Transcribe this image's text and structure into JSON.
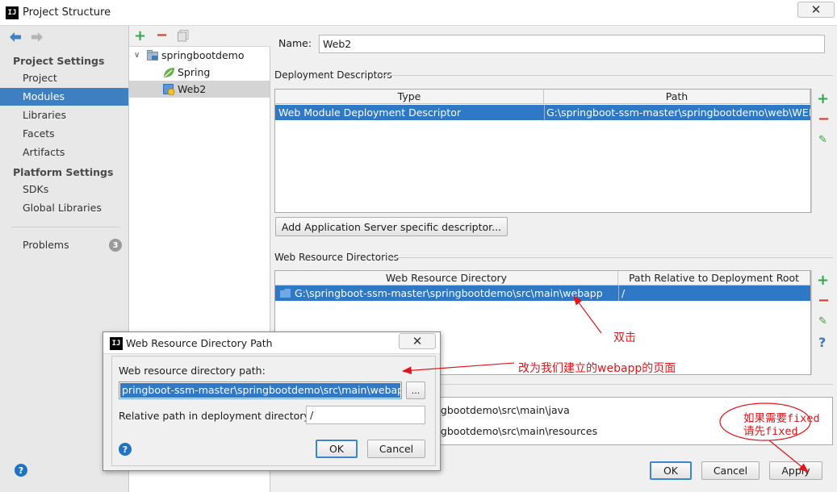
{
  "window": {
    "title": "Project Structure",
    "app_icon": "IJ",
    "close_glyph": "✕"
  },
  "nav": {
    "project_settings_header": "Project Settings",
    "project_settings_items": [
      "Project",
      "Modules",
      "Libraries",
      "Facets",
      "Artifacts"
    ],
    "platform_settings_header": "Platform Settings",
    "platform_settings_items": [
      "SDKs",
      "Global Libraries"
    ],
    "problems_label": "Problems",
    "problems_count": "3",
    "selected": "Modules"
  },
  "tree": {
    "root": "springbootdemo",
    "children": [
      "Spring",
      "Web2"
    ],
    "selected": "Web2"
  },
  "module": {
    "name_label": "Name:",
    "name_value": "Web2"
  },
  "deployment_descriptors": {
    "label": "Deployment Descriptors",
    "columns": [
      "Type",
      "Path"
    ],
    "row": {
      "type": "Web Module Deployment Descriptor",
      "path": "G:\\springboot-ssm-master\\springbootdemo\\web\\WEB-INF\\web.xml"
    },
    "add_button": "Add Application Server specific descriptor..."
  },
  "web_resource_directories": {
    "label": "Web Resource Directories",
    "columns": [
      "Web Resource Directory",
      "Path Relative to Deployment Root"
    ],
    "row": {
      "directory": "G:\\springboot-ssm-master\\springbootdemo\\src\\main\\webapp",
      "relative": "/"
    }
  },
  "source_roots": {
    "rows": [
      "ngbootdemo\\src\\main\\java",
      "ngbootdemo\\src\\main\\resources"
    ]
  },
  "buttons": {
    "ok": "OK",
    "cancel": "Cancel",
    "apply": "Apply"
  },
  "dialog": {
    "title": "Web Resource Directory Path",
    "path_label": "Web resource directory path:",
    "path_value": "pringboot-ssm-master\\springbootdemo\\src\\main\\webapp",
    "browse": "...",
    "relative_label": "Relative path in deployment directory:",
    "relative_value": "/",
    "ok": "OK",
    "cancel": "Cancel",
    "help": "?"
  },
  "annotations": {
    "double_click": "双击",
    "change_to": "改为我们建立的webapp的页面",
    "fixed_line1": "如果需要fixed",
    "fixed_line2": "请先fixed"
  },
  "colors": {
    "selection": "#2e78c5",
    "nav_selected": "#3d7fc0",
    "annotation": "#e0161a",
    "add_green": "#2fa74a",
    "remove_red": "#d8382c"
  }
}
